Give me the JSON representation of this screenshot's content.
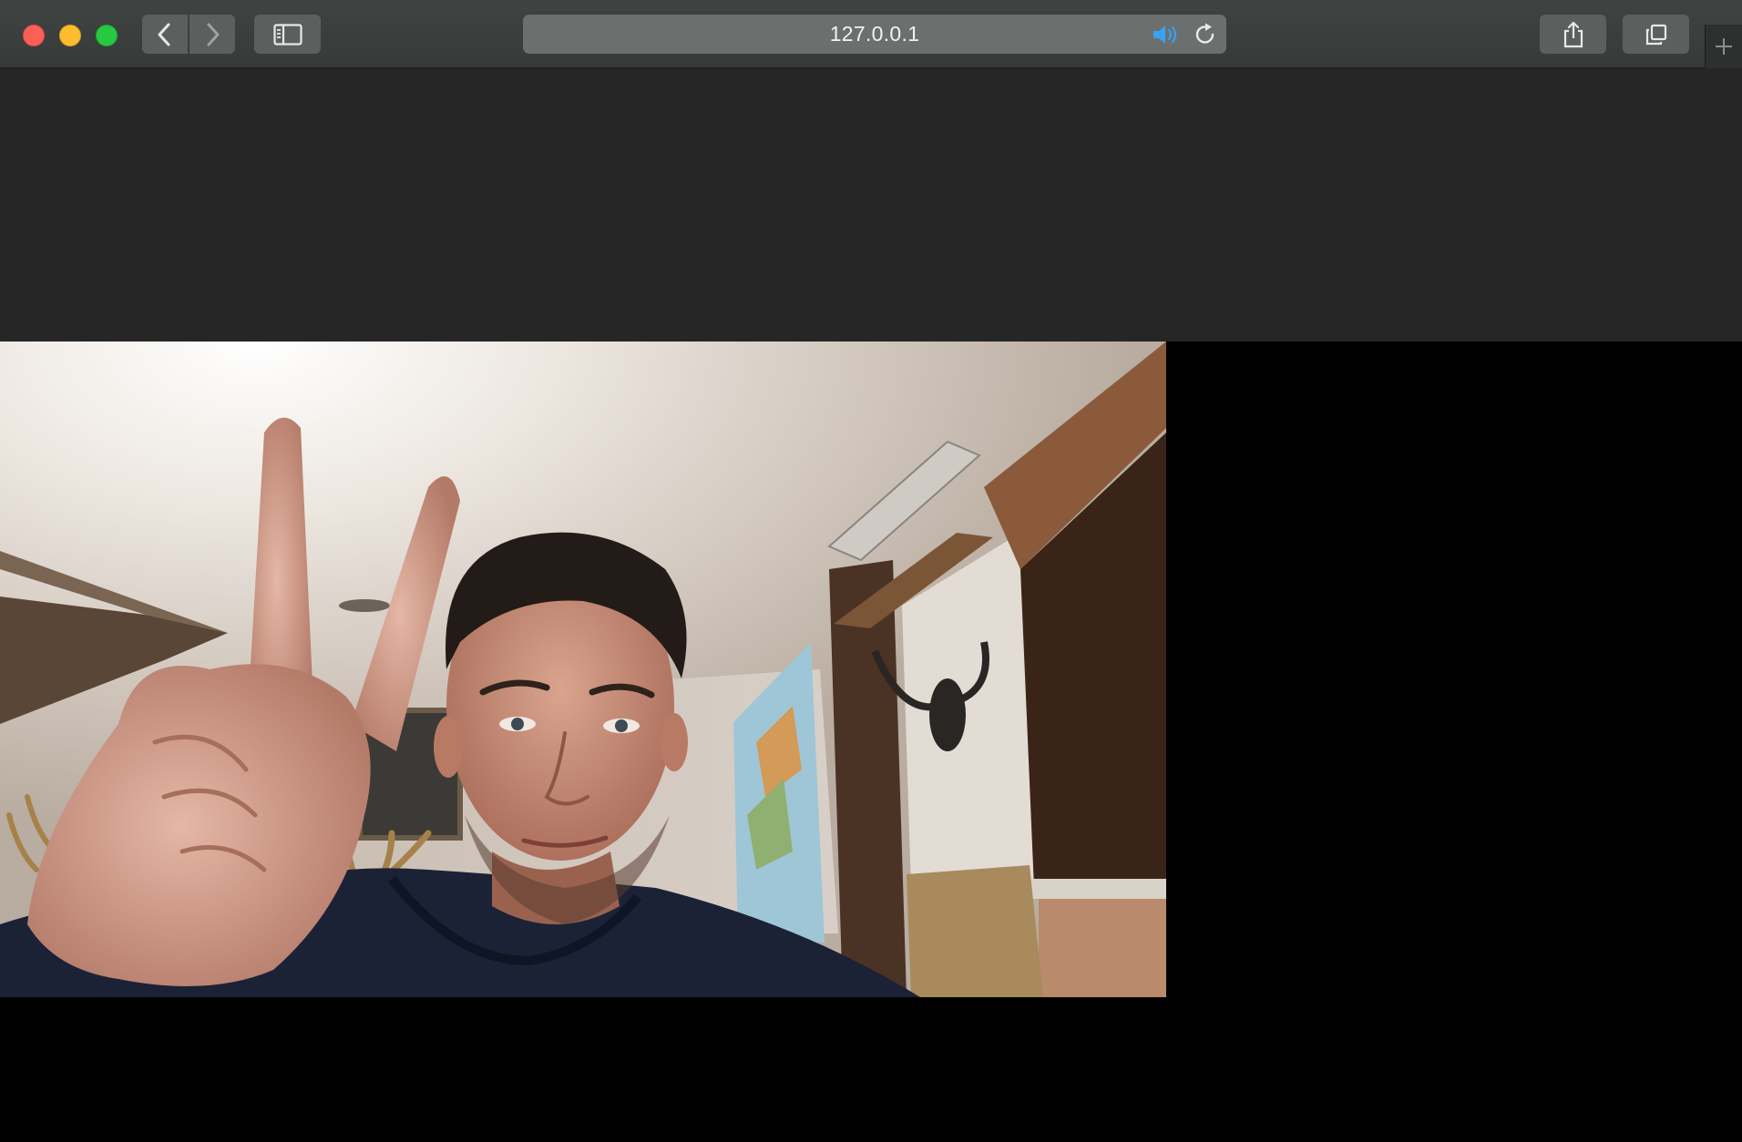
{
  "browser": {
    "address_bar": {
      "url": "127.0.0.1"
    },
    "icons": {
      "back": "chevron-left-icon",
      "forward": "chevron-right-icon",
      "sidebar": "sidebar-icon",
      "audio": "speaker-icon",
      "reload": "reload-icon",
      "share": "share-icon",
      "tabs": "tabs-overview-icon",
      "new_tab": "plus-icon"
    },
    "colors": {
      "close": "#fc5f57",
      "minimize": "#fdbc2e",
      "zoom": "#28c840",
      "audio_active": "#3aa0f0"
    }
  },
  "page": {
    "video": {
      "description_icon": "webcam-video-feed"
    }
  }
}
